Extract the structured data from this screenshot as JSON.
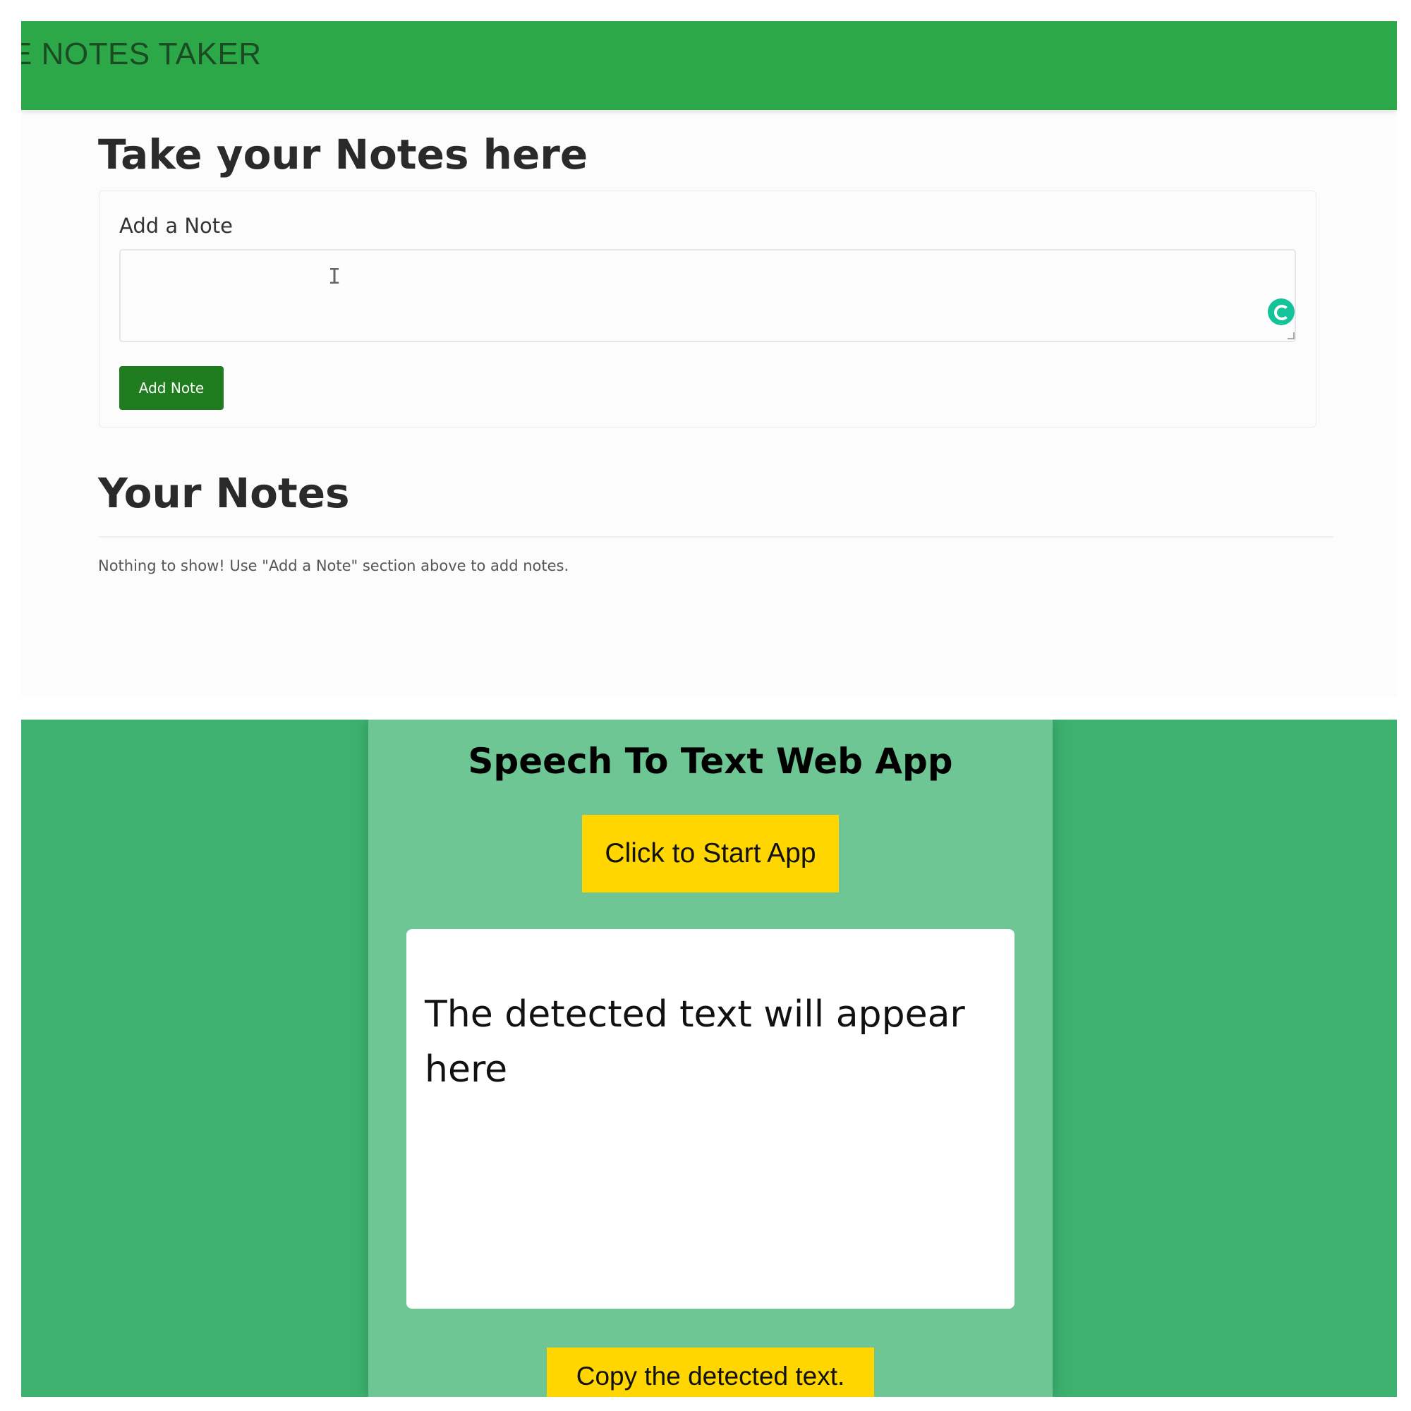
{
  "notes_app": {
    "brand": "E NOTES TAKER",
    "heading": "Take your Notes here",
    "add_card": {
      "title": "Add a Note",
      "textarea_value": "",
      "button_label": "Add Note"
    },
    "notes_heading": "Your Notes",
    "empty_message": "Nothing to show! Use \"Add a Note\" section above to add notes.",
    "colors": {
      "navbar": "#2ca849",
      "button": "#1f7d1f",
      "grammarly": "#15c39a"
    }
  },
  "speech_app": {
    "title": "Speech To Text Web App",
    "start_button_label": "Click to Start App",
    "result_text": "The detected text will appear here",
    "copy_button_label": "Copy the detected text.",
    "colors": {
      "background": "#3db270",
      "container": "#6ec695",
      "button": "#ffd600"
    }
  }
}
